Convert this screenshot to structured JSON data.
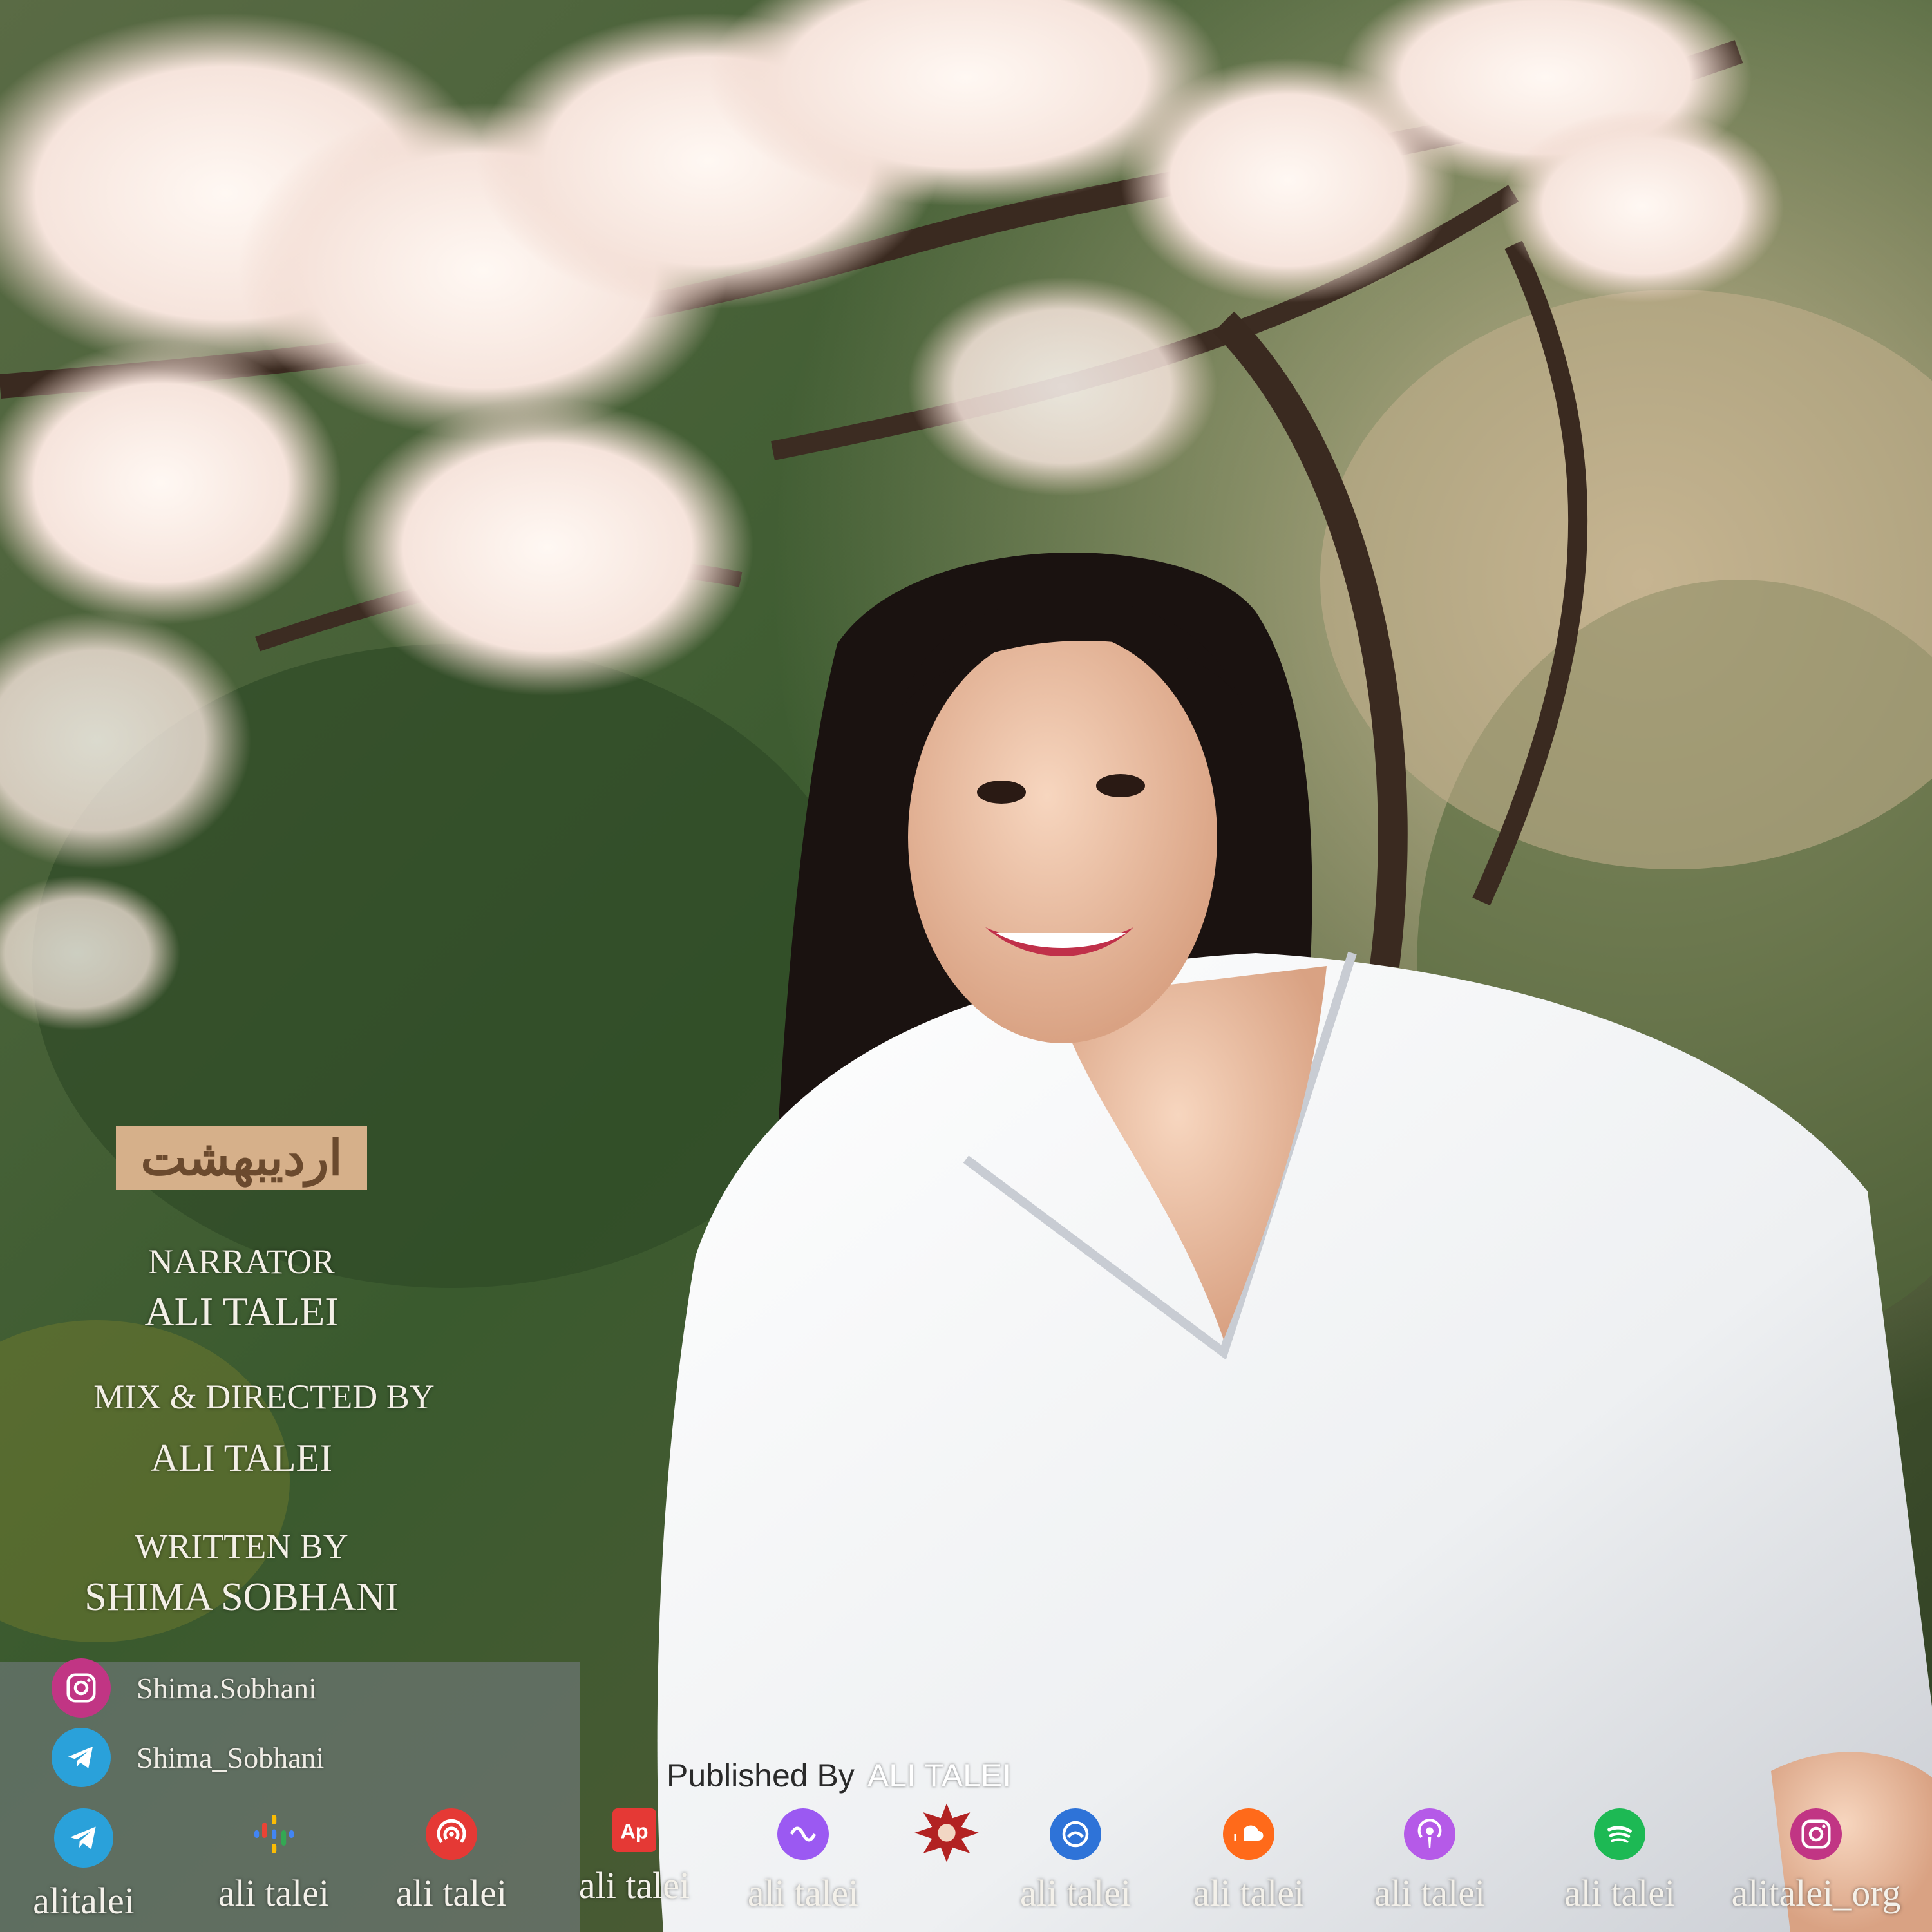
{
  "title": "اردیبهشت",
  "credits": {
    "narrator_label": "NARRATOR",
    "narrator_name": "ALI TALEI",
    "mix_label": "MIX & DIRECTED BY",
    "mix_name": "ALI TALEI",
    "writer_label": "WRITTEN BY",
    "writer_name": "SHIMA SOBHANI"
  },
  "socials": [
    {
      "icon": "instagram-icon",
      "handle": "Shima.Sobhani",
      "color": "#c13584"
    },
    {
      "icon": "telegram-icon",
      "handle": "Shima_Sobhani",
      "color": "#2aa1da"
    }
  ],
  "published": {
    "label": "Published By",
    "name": "ALI TALEI"
  },
  "platforms": [
    {
      "icon": "telegram-icon",
      "label": "alitalei",
      "color": "#2aa1da"
    },
    {
      "icon": "google-podcasts-icon",
      "label": "ali talei",
      "color": "#4285f4"
    },
    {
      "icon": "castbox-icon",
      "label": "ali talei",
      "color": "#e53935"
    },
    {
      "icon": "apple-podcasts-ap-icon",
      "label": "ali talei",
      "color": "#e53935"
    },
    {
      "icon": "podcast-app-icon",
      "label": "ali talei",
      "color": "#9b59f2"
    },
    {
      "icon": "emblem-icon",
      "label": "",
      "color": "#b22222"
    },
    {
      "icon": "podbean-icon",
      "label": "ali talei",
      "color": "#2e73d8"
    },
    {
      "icon": "soundcloud-icon",
      "label": "ali talei",
      "color": "#ff6a1a"
    },
    {
      "icon": "apple-podcasts-icon",
      "label": "ali talei",
      "color": "#b55ae8"
    },
    {
      "icon": "spotify-icon",
      "label": "ali talei",
      "color": "#1db954"
    },
    {
      "icon": "instagram-icon",
      "label": "alitalei_org",
      "color": "#c13584"
    }
  ]
}
